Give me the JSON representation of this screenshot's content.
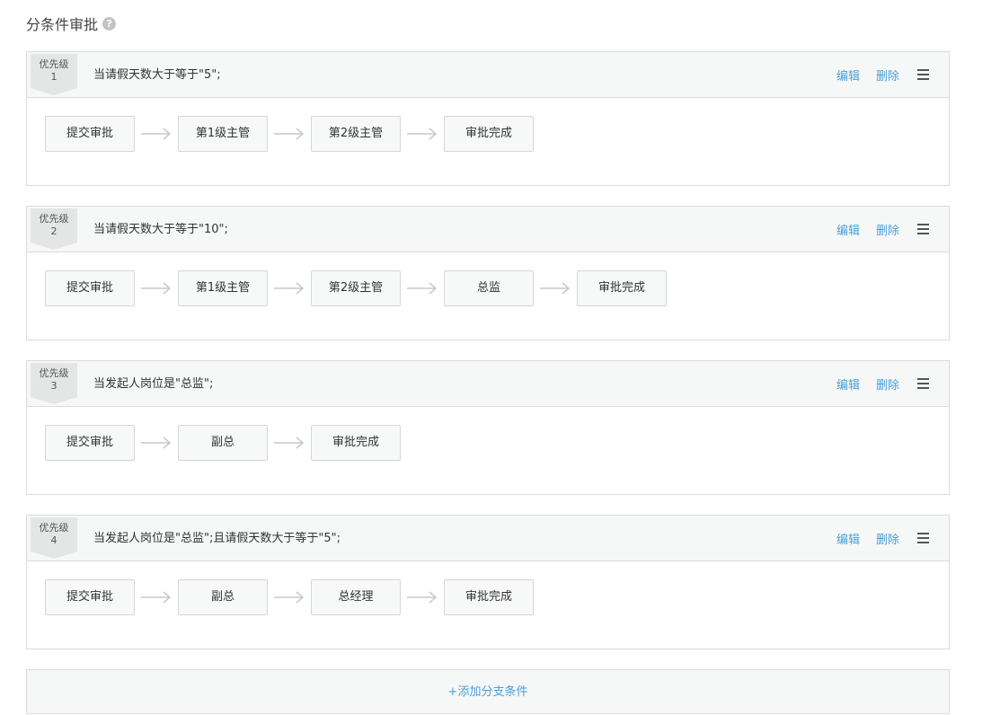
{
  "section": {
    "title": "分条件审批",
    "help_glyph": "?"
  },
  "priority_label": "优先级",
  "actions": {
    "edit": "编辑",
    "delete": "删除"
  },
  "conditions": [
    {
      "priority": "1",
      "text": "当请假天数大于等于\"5\";",
      "steps": [
        "提交审批",
        "第1级主管",
        "第2级主管",
        "审批完成"
      ]
    },
    {
      "priority": "2",
      "text": "当请假天数大于等于\"10\";",
      "steps": [
        "提交审批",
        "第1级主管",
        "第2级主管",
        "总监",
        "审批完成"
      ]
    },
    {
      "priority": "3",
      "text": "当发起人岗位是\"总监\";",
      "steps": [
        "提交审批",
        "副总",
        "审批完成"
      ]
    },
    {
      "priority": "4",
      "text": "当发起人岗位是\"总监\";且请假天数大于等于\"5\";",
      "steps": [
        "提交审批",
        "副总",
        "总经理",
        "审批完成"
      ]
    }
  ],
  "add_branch_label": "+添加分支条件",
  "colors": {
    "link": "#4a9fd8",
    "header_bg": "#f6f7f7",
    "border": "#dcdcdc"
  }
}
